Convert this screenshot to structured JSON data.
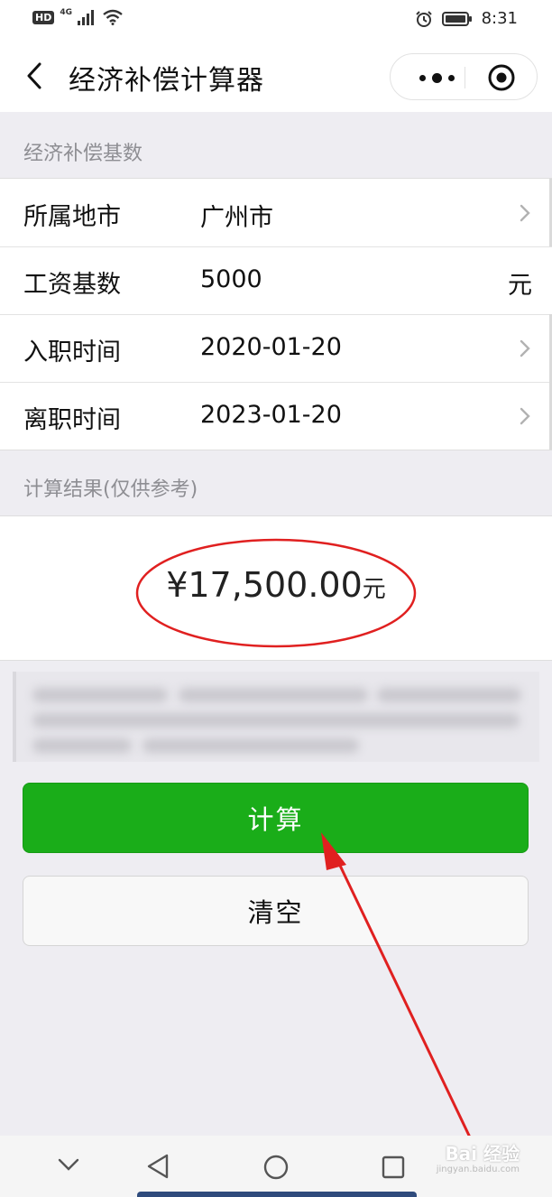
{
  "status_bar": {
    "hd": "HD",
    "network": "4G",
    "time": "8:31"
  },
  "navbar": {
    "title": "经济补偿计算器",
    "back_icon": "chevron-left-icon",
    "more_icon": "more-dots-icon",
    "close_icon": "target-circle-icon"
  },
  "form": {
    "section_label": "经济补偿基数",
    "rows": [
      {
        "label": "所属地市",
        "value": "广州市",
        "trail": "chevron-right-icon"
      },
      {
        "label": "工资基数",
        "value": "5000",
        "unit": "元"
      },
      {
        "label": "入职时间",
        "value": "2020-01-20",
        "trail": "chevron-right-icon"
      },
      {
        "label": "离职时间",
        "value": "2023-01-20",
        "trail": "chevron-right-icon"
      }
    ]
  },
  "result": {
    "section_label": "计算结果(仅供参考)",
    "amount": "¥17,500.00",
    "unit": "元",
    "highlight_color": "#e02020"
  },
  "buttons": {
    "calculate": "计算",
    "clear": "清空",
    "primary_color": "#1aad19"
  },
  "system_nav": {
    "icons": [
      "chevron-down-icon",
      "back-triangle-icon",
      "home-circle-icon",
      "recents-square-icon"
    ]
  },
  "watermark": {
    "text": "Bai 经验",
    "sub": "jingyan.baidu.com"
  }
}
